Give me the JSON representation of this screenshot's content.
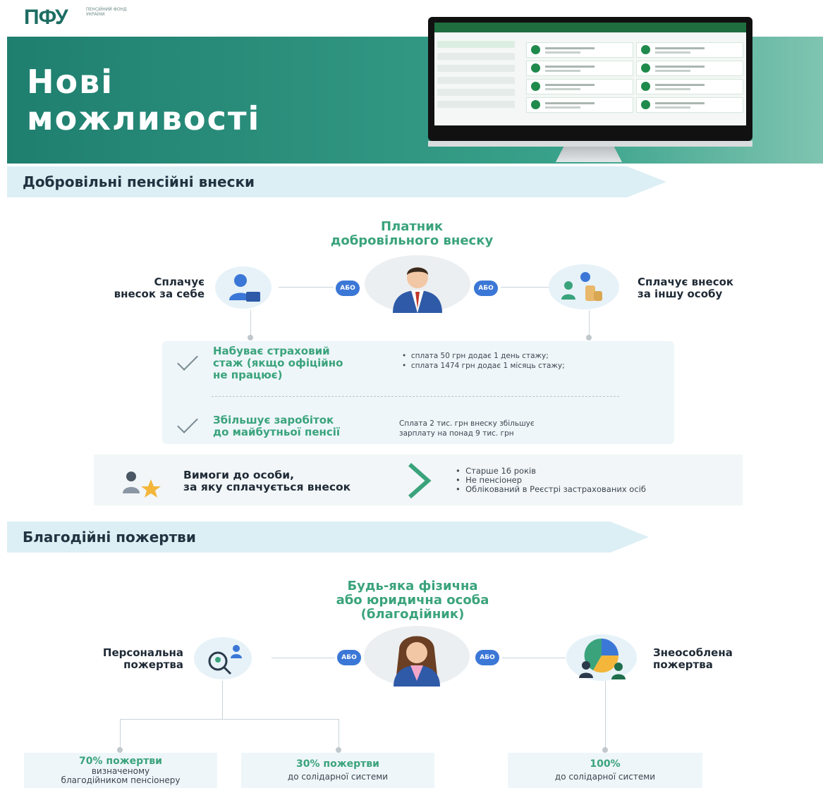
{
  "header": {
    "logo": "ПФУ",
    "logo_caption": "ПЕНСІЙНИЙ ФОНД УКРАЇНИ",
    "title_line1": "Нові",
    "title_line2": "можливості"
  },
  "sections": {
    "voluntary": "Добровільні пенсійні внески",
    "charity": "Благодійні пожертви"
  },
  "voluntary": {
    "payer_line1": "Платник",
    "payer_line2": "добровільного внеску",
    "left_line1": "Сплачує",
    "left_line2": "внесок за себе",
    "right_line1": "Сплачує внесок",
    "right_line2": "за іншу особу",
    "or": "АБО",
    "benefit1_line1": "Набуває страховий",
    "benefit1_line2": "стаж (якщо офіційно",
    "benefit1_line3": "не працює)",
    "benefit1_items": [
      "сплата 50 грн додає 1 день стажу;",
      "сплата 1474 грн додає 1 місяць стажу;"
    ],
    "benefit2_line1": "Збільшує заробіток",
    "benefit2_line2": "до майбутньої пенсії",
    "benefit2_text_line1": "Сплата 2 тис. грн внеску збільшує",
    "benefit2_text_line2": "зарплату на понад 9 тис. грн",
    "req_line1": "Вимоги до особи,",
    "req_line2": "за яку сплачується внесок",
    "req_items": [
      "Старше 16 років",
      "Не пенсіонер",
      "Облікований в Реєстрі застрахованих осіб"
    ]
  },
  "charity": {
    "donor_line1": "Будь-яка фізична",
    "donor_line2": "або юридична особа",
    "donor_line3": "(благодійник)",
    "left_line1": "Персональна",
    "left_line2": "пожертва",
    "right_line1": "Знеособлена",
    "right_line2": "пожертва",
    "or": "АБО",
    "box1_pct": "70% пожертви",
    "box1_line1": "визначеному",
    "box1_line2": "благодійником пенсіонеру",
    "box2_pct": "30% пожертви",
    "box2_line1": "до солідарної системи",
    "box3_pct": "100%",
    "box3_line1": "до солідарної системи"
  },
  "colors": {
    "accent_green": "#3aa37c",
    "header_teal": "#2f9480",
    "badge_blue": "#3b77d6"
  }
}
